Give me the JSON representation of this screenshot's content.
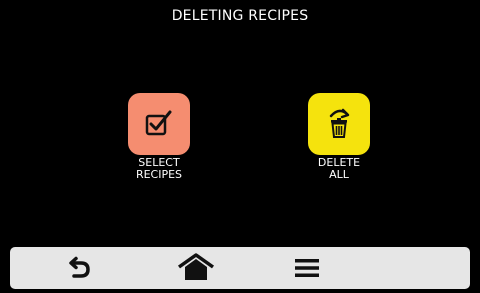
{
  "header": {
    "title": "DELETING RECIPES"
  },
  "actions": {
    "select_recipes": {
      "label_line1": "SELECT",
      "label_line2": "RECIPES",
      "icon": "checkbox-icon",
      "color": "#f58d70"
    },
    "delete_all": {
      "label_line1": "DELETE",
      "label_line2": "ALL",
      "icon": "trash-icon",
      "color": "#f5e30d"
    }
  },
  "bottom_bar": {
    "items": [
      {
        "icon": "back-arrow-icon"
      },
      {
        "icon": "home-icon"
      },
      {
        "icon": "menu-icon"
      }
    ],
    "background": "#e6e6e6"
  }
}
